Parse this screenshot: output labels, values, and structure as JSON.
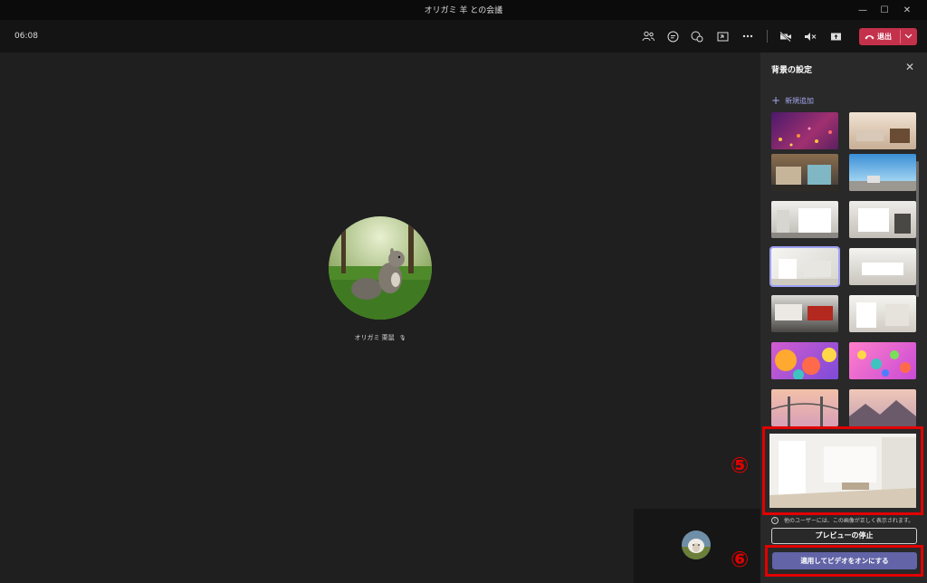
{
  "window": {
    "title": "オリガミ 羊 との会議",
    "minimize": "—",
    "maximize": "☐",
    "close": "✕"
  },
  "toolbar": {
    "timer": "06:08",
    "icons": [
      "participants-icon",
      "chat-icon",
      "reactions-icon",
      "share-tray-icon",
      "more-icon",
      "camera-off-icon",
      "mute-icon",
      "share-icon"
    ],
    "leave_label": "退出",
    "leave_color": "#c4314b"
  },
  "stage": {
    "participant_name": "オリガミ 栗鼠"
  },
  "panel": {
    "title": "背景の設定",
    "add_new": "新規追加",
    "info_text": "他のユーザーには、この画像が正しく表示されます。",
    "stop_preview": "プレビューの停止",
    "apply": "適用してビデオをオンにする",
    "accent": "#6264a7"
  },
  "callouts": {
    "five": "⑤",
    "six": "⑥"
  }
}
